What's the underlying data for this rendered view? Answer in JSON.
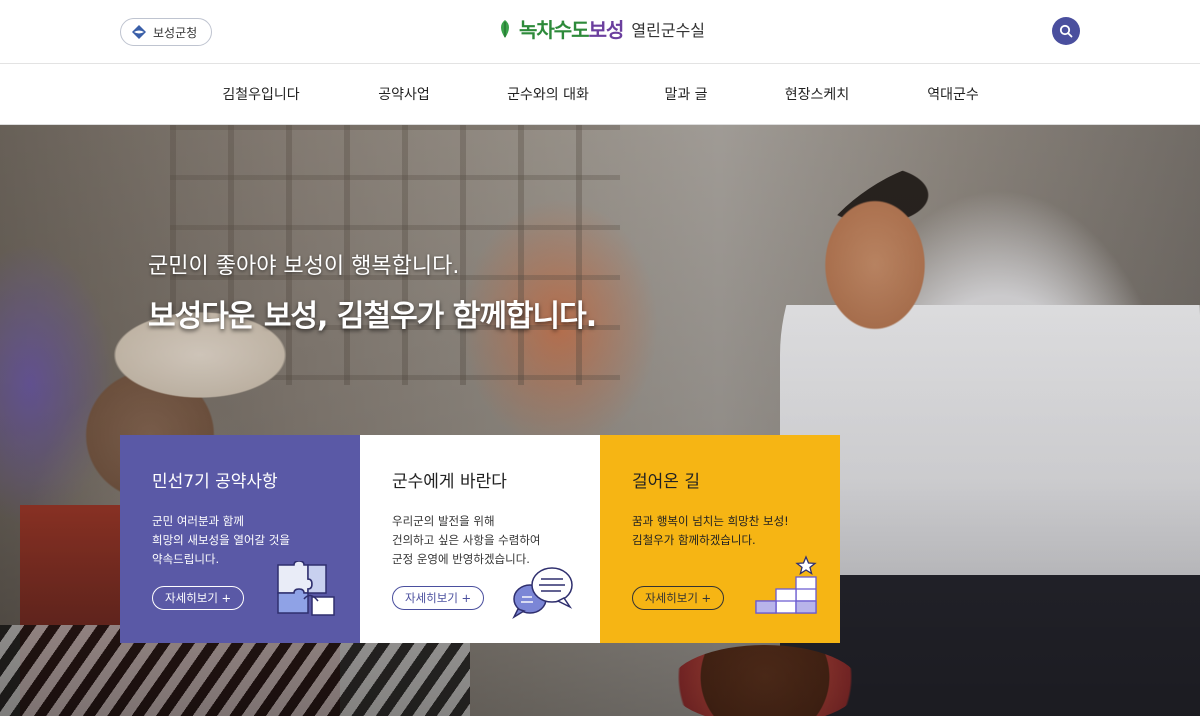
{
  "header": {
    "county_button_label": "보성군청",
    "logo_brand_part1": "녹차수도",
    "logo_brand_part2": "보성",
    "logo_site_name": "열린군수실"
  },
  "nav": {
    "items": [
      "김철우입니다",
      "공약사업",
      "군수와의 대화",
      "말과 글",
      "현장스케치",
      "역대군수"
    ]
  },
  "hero": {
    "slogan_line1": "군민이 좋아야 보성이 행복합니다.",
    "slogan_line2": "보성다운 보성, 김철우가 함께합니다."
  },
  "cards": [
    {
      "title": "민선7기 공약사항",
      "desc": "군민 여러분과 함께\n희망의 새보성을 열어갈 것을\n약속드립니다.",
      "more": "자세히보기 +",
      "icon": "puzzle-icon",
      "color": "#5a59a6"
    },
    {
      "title": "군수에게 바란다",
      "desc": "우리군의 발전을 위해\n건의하고 싶은 사항을 수렴하여\n군정 운영에 반영하겠습니다.",
      "more": "자세히보기 +",
      "icon": "speech-bubbles-icon",
      "color": "#ffffff"
    },
    {
      "title": "걸어온 길",
      "desc": "꿈과 행복이 넘치는 희망찬 보성!\n김철우가 함께하겠습니다.",
      "more": "자세히보기 +",
      "icon": "stairs-star-icon",
      "color": "#f6b514"
    }
  ],
  "colors": {
    "accent_purple": "#4a4f9e",
    "card_purple": "#5a59a6",
    "card_yellow": "#f6b514"
  }
}
